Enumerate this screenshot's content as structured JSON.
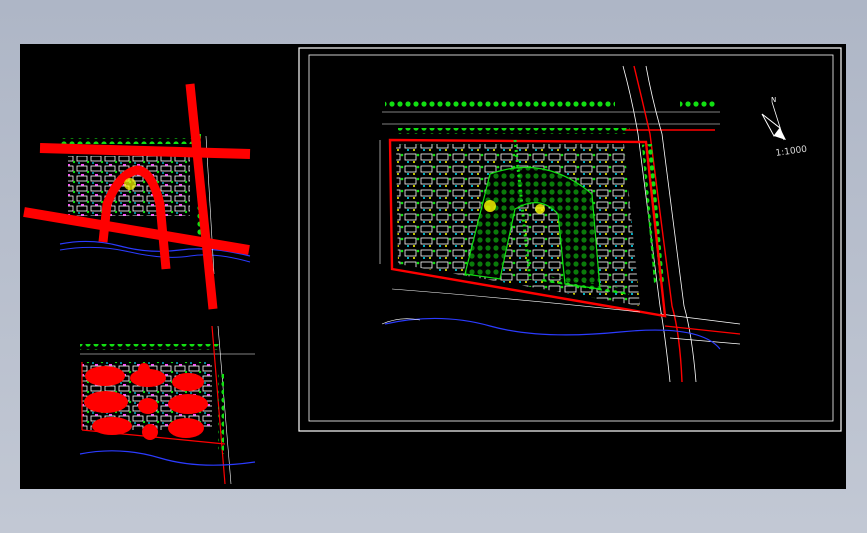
{
  "canvas": {
    "background": "#000000",
    "window_background": "#b8bfcc"
  },
  "drawing": {
    "scale_label": "1:1000",
    "north_arrow_label": "N",
    "frame_color": "#ffffff",
    "road_color": "#ff0000",
    "boundary_color": "#ff0000",
    "river_color": "#2b3bff",
    "vegetation_color": "#12e012",
    "building_color": "#ffffff"
  },
  "panels": [
    {
      "name": "road-structure-diagram",
      "overlay": "road-axes"
    },
    {
      "name": "functional-zoning-diagram",
      "overlay": "zone-blobs"
    },
    {
      "name": "master-site-plan",
      "overlay": "none"
    }
  ]
}
